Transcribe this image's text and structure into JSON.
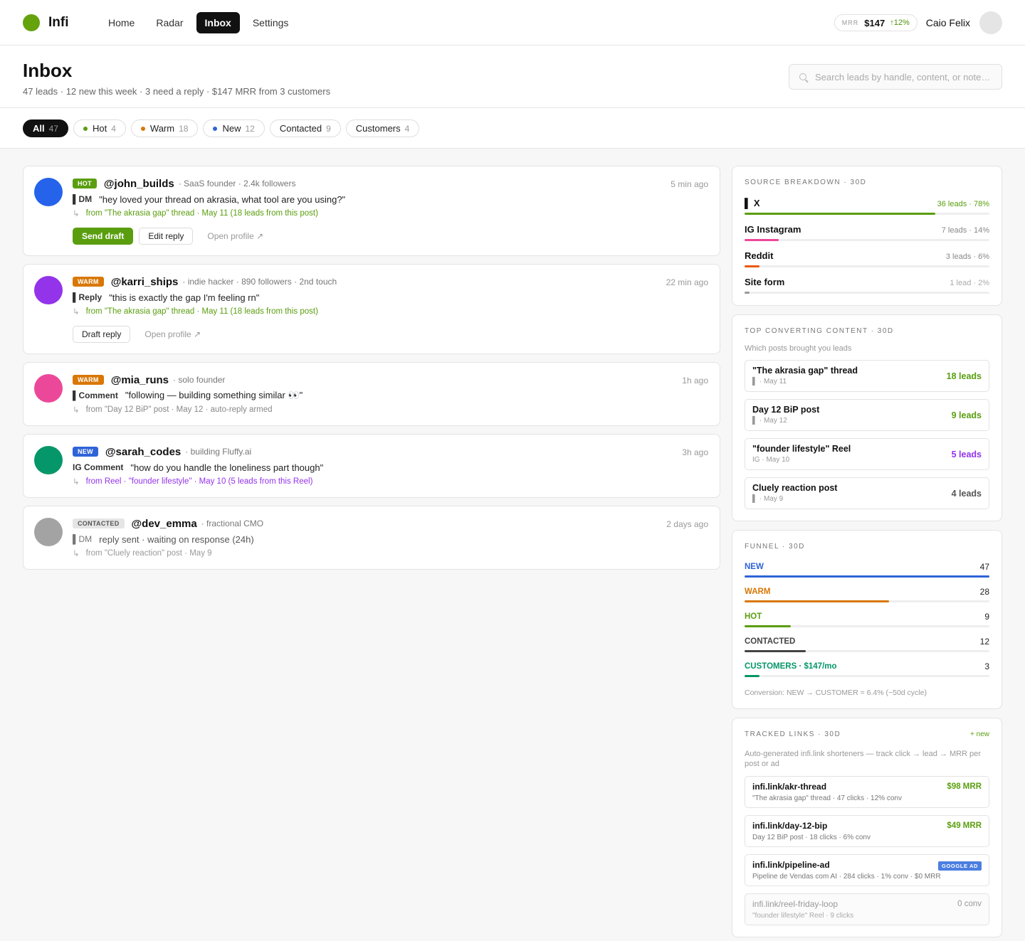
{
  "app": {
    "name": "Infi"
  },
  "nav": {
    "items": [
      {
        "label": "Home"
      },
      {
        "label": "Radar"
      },
      {
        "label": "Inbox"
      },
      {
        "label": "Settings"
      }
    ]
  },
  "mrr": {
    "label": "MRR",
    "value": "$147",
    "delta": "↑12%"
  },
  "user": {
    "name": "Caio Felix"
  },
  "page": {
    "title": "Inbox",
    "subtitle": "47 leads · 12 new this week · 3 need a reply · $147 MRR from 3 customers"
  },
  "search": {
    "placeholder": "Search leads by handle, content, or note…"
  },
  "filters": [
    {
      "label": "All",
      "count": "47",
      "color": ""
    },
    {
      "label": "Hot",
      "count": "4",
      "color": "#5a9e0f"
    },
    {
      "label": "Warm",
      "count": "18",
      "color": "#d97706"
    },
    {
      "label": "New",
      "count": "12",
      "color": "#2f63d8"
    },
    {
      "label": "Contacted",
      "count": "9",
      "color": ""
    },
    {
      "label": "Customers",
      "count": "4",
      "color": ""
    }
  ],
  "leads": [
    {
      "badge": "HOT",
      "badge_color": "#5a9e0f",
      "handle": "@john_builds",
      "meta": "· SaaS founder · 2.4k followers",
      "time": "5 min ago",
      "avatar_color": "#2563eb",
      "msg_type": "▌DM",
      "message": "\"hey loved your thread on akrasia, what tool are you using?\"",
      "source": "from \"The akrasia gap\" thread · May 11 (18 leads from this post)",
      "source_color": "#5a9e0f",
      "primary_action": "Send draft",
      "secondary_action": "Edit reply",
      "link_action": "Open profile ↗"
    },
    {
      "badge": "WARM",
      "badge_color": "#d97706",
      "handle": "@karri_ships",
      "meta": "· indie hacker · 890 followers · 2nd touch",
      "time": "22 min ago",
      "avatar_color": "#9333ea",
      "msg_type": "▌Reply",
      "message": "\"this is exactly the gap I'm feeling rn\"",
      "source": "from \"The akrasia gap\" thread · May 11 (18 leads from this post)",
      "source_color": "#5a9e0f",
      "secondary_action": "Draft reply",
      "link_action": "Open profile ↗"
    },
    {
      "badge": "WARM",
      "badge_color": "#d97706",
      "handle": "@mia_runs",
      "meta": "· solo founder",
      "time": "1h ago",
      "avatar_color": "#ec4899",
      "msg_type": "▌Comment",
      "message": "\"following — building something similar 👀\"",
      "source": "from \"Day 12 BiP\" post · May 12 · auto-reply armed",
      "source_color": "#888"
    },
    {
      "badge": "NEW",
      "badge_color": "#2f63d8",
      "handle": "@sarah_codes",
      "meta": "· building Fluffy.ai",
      "time": "3h ago",
      "avatar_color": "#059669",
      "msg_type": "IG Comment",
      "message": "\"how do you handle the loneliness part though\"",
      "source": "from Reel · \"founder lifestyle\" · May 10 (5 leads from this Reel)",
      "source_color": "#9333ea"
    },
    {
      "badge": "CONTACTED",
      "badge_color": "#e5e5e5",
      "handle": "@dev_emma",
      "meta": "· fractional CMO",
      "time": "2 days ago",
      "avatar_color": "#a3a3a3",
      "msg_type": "▌DM",
      "message": "reply sent · waiting on response (24h)",
      "source": "from \"Cluely reaction\" post · May 9",
      "source_color": "#999"
    }
  ],
  "source_breakdown": {
    "title": "SOURCE BREAKDOWN · 30d",
    "items": [
      {
        "name": "▌ X",
        "stat": "36 leads · 78%",
        "share": 0.78,
        "color": "#5a9e0f"
      },
      {
        "name": "IG Instagram",
        "stat": "7 leads · 14%",
        "share": 0.14,
        "color": "#ec4899"
      },
      {
        "name": "Reddit",
        "stat": "3 leads · 6%",
        "share": 0.06,
        "color": "#ea580c"
      },
      {
        "name": "Site form",
        "stat": "1 lead · 2%",
        "share": 0.02,
        "color": "#999999"
      }
    ]
  },
  "top_content": {
    "title": "TOP CONVERTING CONTENT · 30d",
    "subtitle": "Which posts brought you leads",
    "items": [
      {
        "title": "\"The akrasia gap\" thread",
        "meta": "▌ · May 11",
        "value": "18 leads",
        "color": "#5a9e0f"
      },
      {
        "title": "Day 12 BiP post",
        "meta": "▌ · May 12",
        "value": "9 leads",
        "color": "#5a9e0f"
      },
      {
        "title": "\"founder lifestyle\" Reel",
        "meta": "IG · May 10",
        "value": "5 leads",
        "color": "#9333ea"
      },
      {
        "title": "Cluely reaction post",
        "meta": "▌ · May 9",
        "value": "4 leads",
        "color": "#555555"
      }
    ]
  },
  "funnel": {
    "title": "FUNNEL · 30d",
    "items": [
      {
        "name": "NEW",
        "count": "47",
        "share": 1.0,
        "color": "#2f63d8"
      },
      {
        "name": "WARM",
        "count": "28",
        "share": 0.59,
        "color": "#d97706"
      },
      {
        "name": "HOT",
        "count": "9",
        "share": 0.19,
        "color": "#5a9e0f"
      },
      {
        "name": "CONTACTED",
        "count": "12",
        "share": 0.25,
        "color": "#444444"
      },
      {
        "name": "CUSTOMERS · $147/mo",
        "count": "3",
        "share": 0.06,
        "color": "#059669"
      }
    ],
    "note": "Conversion: NEW → CUSTOMER = 6.4% (~50d cycle)"
  },
  "tracked_links": {
    "title": "TRACKED LINKS · 30d",
    "new_label": "+ new",
    "subtitle": "Auto-generated infi.link shorteners — track click → lead → MRR per post or ad",
    "items": [
      {
        "url": "infi.link/akr-thread",
        "meta": "\"The akrasia gap\" thread · 47 clicks · 12% conv",
        "value": "$98 MRR"
      },
      {
        "url": "infi.link/day-12-bip",
        "meta": "Day 12 BiP post · 18 clicks · 6% conv",
        "value": "$49 MRR"
      },
      {
        "url": "infi.link/pipeline-ad",
        "meta": "Pipeline de Vendas com AI · 284 clicks · 1% conv · $0 MRR",
        "badge": "GOOGLE AD"
      },
      {
        "url": "infi.link/reel-friday-loop",
        "meta": "\"founder lifestyle\" Reel · 9 clicks",
        "value": "0 conv"
      }
    ]
  }
}
